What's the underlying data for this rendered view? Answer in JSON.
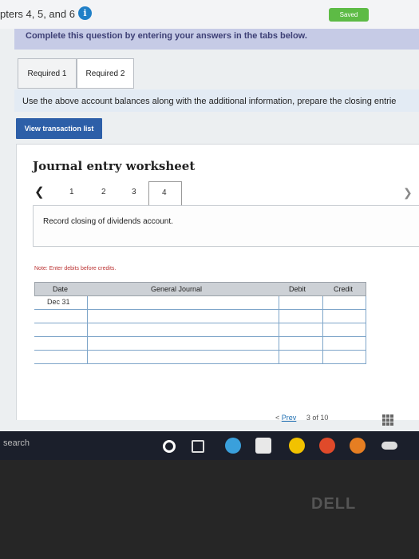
{
  "header": {
    "title": "pters 4, 5, and 6",
    "saved_label": "Saved"
  },
  "instruction": "Complete this question by entering your answers in the tabs below.",
  "tabs": [
    {
      "label": "Required 1"
    },
    {
      "label": "Required 2"
    }
  ],
  "info_text": "Use the above account balances along with the additional information, prepare the closing entrie",
  "view_button": "View transaction list",
  "worksheet": {
    "title": "Journal entry worksheet",
    "pages": [
      "1",
      "2",
      "3",
      "4"
    ],
    "current_page": "4",
    "entry_description": "Record closing of dividends account.",
    "note": "Note: Enter debits before credits."
  },
  "journal": {
    "headers": {
      "date": "Date",
      "account": "General Journal",
      "debit": "Debit",
      "credit": "Credit"
    },
    "first_date": "Dec 31"
  },
  "pager": {
    "prev": "Prev",
    "position": "3 of 10"
  },
  "taskbar": {
    "search": "search"
  },
  "brand": "DELL",
  "colors": {
    "saved": "#5dbb45",
    "view_button": "#2d5fa8",
    "info_icon": "#1f7fc7"
  }
}
